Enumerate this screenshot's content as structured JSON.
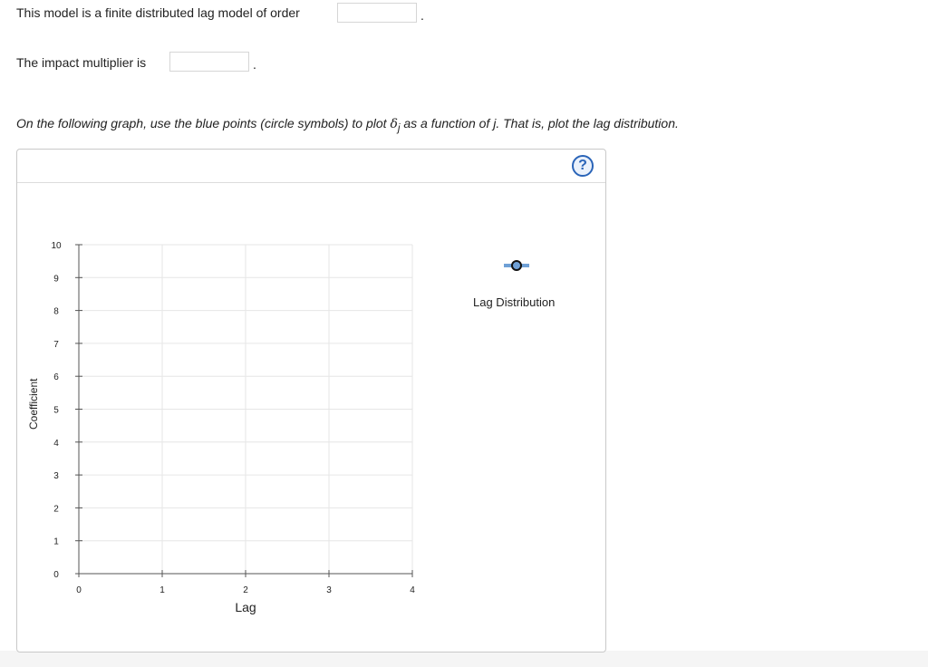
{
  "question": {
    "order_prompt": "This model is a finite distributed lag model of order",
    "order_answer": "",
    "impact_prompt": "The impact multiplier is",
    "impact_answer": "",
    "period": "."
  },
  "instruction": {
    "prefix": "On the following graph, use the blue points (circle symbols) to plot ",
    "symbol": "δ",
    "subscript": "j",
    "middle": " as a function of ",
    "variable": "j",
    "suffix": ". That is, plot the lag distribution."
  },
  "graph": {
    "help_icon": "?",
    "legend_label": "Lag Distribution",
    "legend_icon": "circle-point-tool-icon",
    "point_color": "#6fa0d6",
    "marker_stroke": "#111111"
  },
  "chart_data": {
    "type": "scatter",
    "xlabel": "Lag",
    "ylabel": "Coefficient",
    "xlim": [
      0,
      4
    ],
    "ylim": [
      0,
      10
    ],
    "x_ticks": [
      0,
      1,
      2,
      3,
      4
    ],
    "y_ticks": [
      0,
      1,
      2,
      3,
      4,
      5,
      6,
      7,
      8,
      9,
      10
    ],
    "grid": true,
    "series": [
      {
        "points": []
      }
    ]
  }
}
